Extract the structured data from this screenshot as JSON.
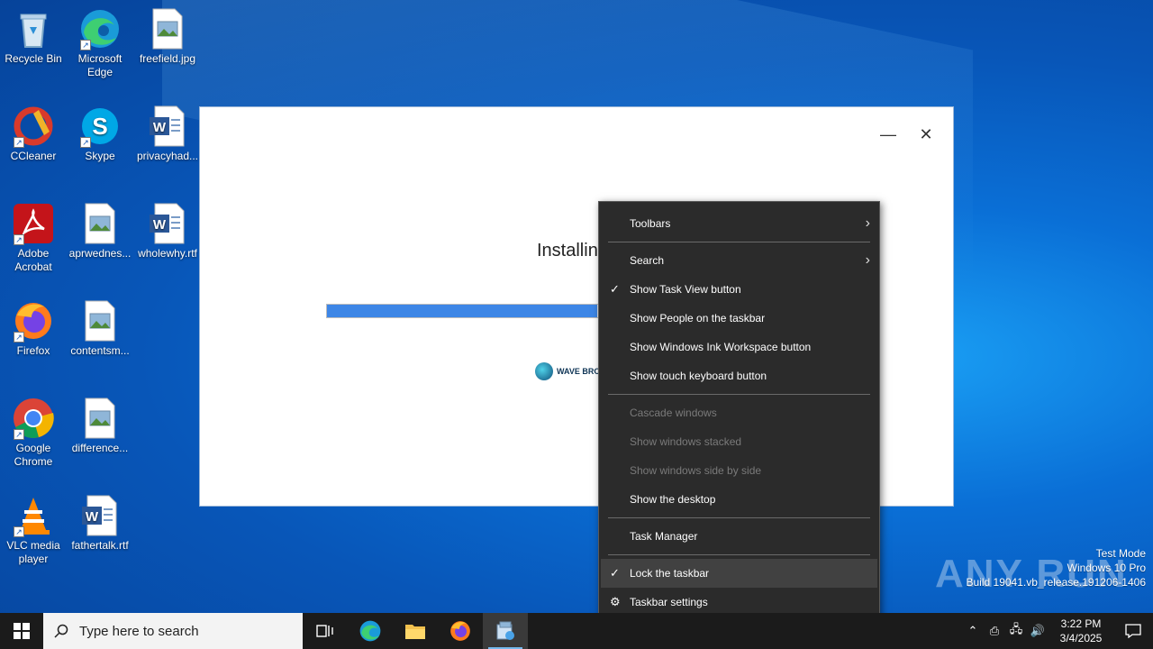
{
  "desktop": {
    "icons": [
      {
        "label": "Recycle Bin",
        "icon": "recycle-bin-icon"
      },
      {
        "label": "Microsoft Edge",
        "icon": "edge-icon"
      },
      {
        "label": "freefield.jpg",
        "icon": "image-file-icon"
      },
      {
        "label": "CCleaner",
        "icon": "ccleaner-icon"
      },
      {
        "label": "Skype",
        "icon": "skype-icon"
      },
      {
        "label": "privacyhad...",
        "icon": "word-doc-icon"
      },
      {
        "label": "Adobe Acrobat",
        "icon": "acrobat-icon"
      },
      {
        "label": "aprwednes...",
        "icon": "image-file-icon"
      },
      {
        "label": "wholewhy.rtf",
        "icon": "word-doc-icon"
      },
      {
        "label": "Firefox",
        "icon": "firefox-icon"
      },
      {
        "label": "contentsm...",
        "icon": "image-file-icon"
      },
      {
        "label": "Google Chrome",
        "icon": "chrome-icon"
      },
      {
        "label": "difference...",
        "icon": "image-file-icon"
      },
      {
        "label": "VLC media player",
        "icon": "vlc-icon"
      },
      {
        "label": "fathertalk.rtf",
        "icon": "word-doc-icon"
      }
    ]
  },
  "installer": {
    "status_text": "Installin",
    "progress_fraction": 0.58,
    "logo_text": "WAVE BROW",
    "minimize_glyph": "—",
    "close_glyph": "✕"
  },
  "context_menu": {
    "items": [
      {
        "label": "Toolbars",
        "submenu": true
      },
      {
        "label": "Search",
        "submenu": true
      },
      {
        "label": "Show Task View button",
        "checked": true
      },
      {
        "label": "Show People on the taskbar"
      },
      {
        "label": "Show Windows Ink Workspace button"
      },
      {
        "label": "Show touch keyboard button"
      },
      {
        "label": "Cascade windows",
        "disabled": true
      },
      {
        "label": "Show windows stacked",
        "disabled": true
      },
      {
        "label": "Show windows side by side",
        "disabled": true
      },
      {
        "label": "Show the desktop"
      },
      {
        "label": "Task Manager"
      },
      {
        "label": "Lock the taskbar",
        "checked": true,
        "highlighted": true
      },
      {
        "label": "Taskbar settings",
        "icon": "gear-icon"
      }
    ]
  },
  "watermark": {
    "brand": "ANY RUN",
    "line1": "Test Mode",
    "line2": "Windows 10 Pro",
    "line3": "Build 19041.vb_release.191206-1406"
  },
  "taskbar": {
    "search_placeholder": "Type here to search",
    "apps": [
      "task-view-icon",
      "edge-icon",
      "file-explorer-icon",
      "firefox-icon",
      "installer-app-icon"
    ],
    "clock_time": "3:22 PM",
    "clock_date": "3/4/2025"
  },
  "colors": {
    "menu_bg": "#2b2b2b",
    "taskbar_bg": "#1b1b1b",
    "progress": "#3d86e6",
    "desktop_blue": "#0a6fd6"
  }
}
